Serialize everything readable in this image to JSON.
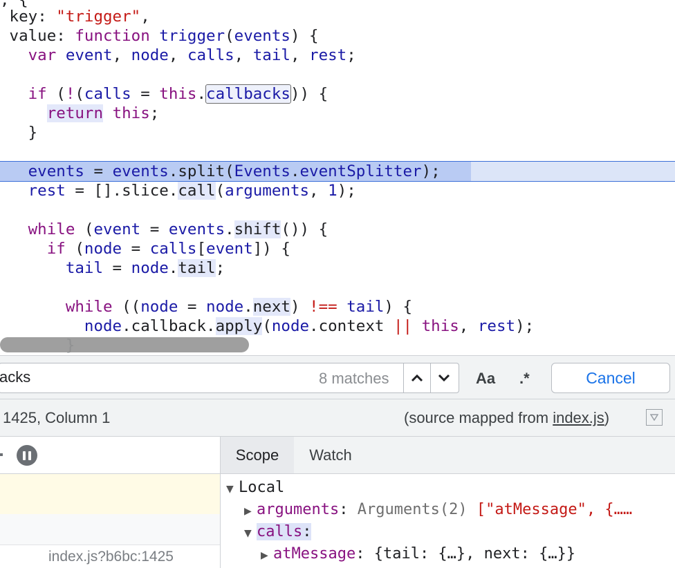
{
  "editor": {
    "lines": [
      {
        "prefix": ", {",
        "rest": ""
      },
      {
        "key_label": "key",
        "key_value": "\"trigger\""
      },
      {
        "value_label": "value",
        "kw_function": "function",
        "fn_name": "trigger",
        "param": "events"
      },
      {
        "kw": "var",
        "vars": [
          "event",
          "node",
          "calls",
          "tail",
          "rest"
        ]
      },
      {
        "kw_if": "if",
        "assign_var": "calls",
        "this_kw": "this",
        "prop": "callbacks"
      },
      {
        "kw_return": "return",
        "this_kw": "this"
      },
      {
        "brace": "}"
      },
      {
        "lhs": "events",
        "obj": "events",
        "method": "split",
        "arg_obj": "Events",
        "arg_prop": "eventSplitter"
      },
      {
        "lhs": "rest",
        "code": "[].slice",
        "method": "call",
        "arg": "arguments",
        "num": "1"
      },
      {
        "kw_while": "while",
        "v1": "event",
        "obj": "events",
        "method": "shift"
      },
      {
        "kw_if": "if",
        "v1": "node",
        "obj": "calls",
        "idx": "event"
      },
      {
        "lhs": "tail",
        "obj": "node",
        "prop": "tail"
      },
      {
        "kw_while": "while",
        "v1": "node",
        "obj": "node",
        "prop": "next",
        "op": "!==",
        "v2": "tail"
      },
      {
        "obj": "node",
        "prop": "callback",
        "method": "apply",
        "arg_obj": "node",
        "arg_prop": "context",
        "op": "||",
        "this_kw": "this",
        "arg2": "rest"
      },
      {
        "brace": "}"
      }
    ]
  },
  "search": {
    "query": "acks",
    "match_count": "8 matches",
    "prev_icon": "chevron-up-icon",
    "next_icon": "chevron-down-icon",
    "case_label": "Aa",
    "regex_label": ".*",
    "cancel_label": "Cancel"
  },
  "status": {
    "cursor_position": "1425, Column 1",
    "source_mapped_prefix": "(source mapped from ",
    "source_mapped_link": "index.js",
    "source_mapped_suffix": ")"
  },
  "call_stack": {
    "frame_location": "index.js?b6bc:1425"
  },
  "scope_panel": {
    "tabs": [
      "Scope",
      "Watch"
    ],
    "local_label": "Local",
    "rows": [
      {
        "name": "arguments",
        "value_type": "Arguments(2)",
        "value_preview": "[\"atMessage\", {……"
      },
      {
        "name": "calls",
        "value_preview": ""
      },
      {
        "name": "atMessage",
        "value_preview": "{tail: {…}, next: {…}}"
      }
    ]
  },
  "colors": {
    "keyword": "#881280",
    "string": "#c41a16",
    "identifier": "#1a1aa6",
    "exec_line": "#dce5f8",
    "link": "#1a73e8"
  }
}
